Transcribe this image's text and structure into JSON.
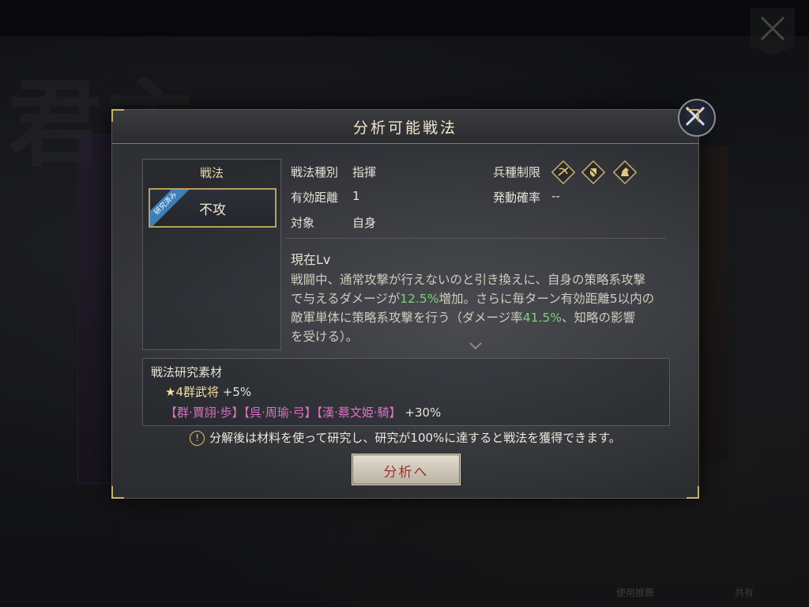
{
  "background": {
    "bottom_items": [
      "使用推薦",
      "共有"
    ]
  },
  "dialog": {
    "title": "分析可能戦法",
    "left_panel": {
      "title": "戦法",
      "skill_name": "不攻",
      "ribbon": "研究済み"
    },
    "stats": {
      "type_label": "戦法種別",
      "type_value": "指揮",
      "range_label": "有効距離",
      "range_value": "1",
      "target_label": "対象",
      "target_value": "自身",
      "troop_label": "兵種制限",
      "rate_label": "発動確率",
      "rate_value": "--"
    },
    "troop_icons": [
      "crossbow-troop-icon",
      "shield-troop-icon",
      "cavalry-troop-icon"
    ],
    "description": {
      "title": "現在Lv",
      "line1": "戦闘中、通常攻撃が行えないのと引き換えに、自身の策略系攻撃",
      "line2_a": "で与えるダメージが",
      "line2_hl": "12.5%",
      "line2_b": "増加。さらに毎ターン有効距離5以内の",
      "line3_a": "敵軍単体に策略系攻撃を行う（ダメージ率",
      "line3_hl": "41.5%",
      "line3_b": "、知略の影響",
      "line4": "を受ける）。"
    },
    "materials": {
      "title": "戦法研究素材",
      "star_item": "★4群武将",
      "star_bonus": "+5%",
      "heroes": "【群·賈詡·歩】【呉·周瑜·弓】【漢·蔡文姫·騎】",
      "heroes_bonus": "+30%"
    },
    "notice": "分解後は材料を使って研究し、研究が100%に達すると戦法を獲得できます。",
    "analyze_button": "分析へ"
  },
  "colors": {
    "highlight_green": "#7ed07a",
    "hero_pink": "#e070c8",
    "gold": "#c8b070",
    "button_text": "#a0322a"
  }
}
